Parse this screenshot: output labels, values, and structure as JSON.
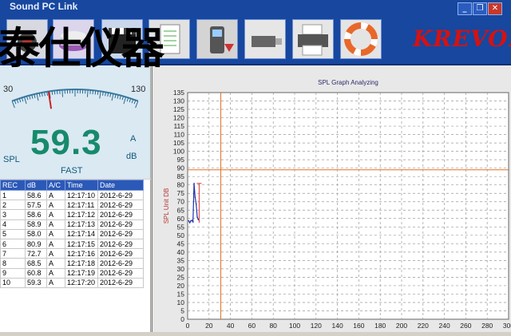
{
  "window": {
    "title": "Sound PC Link",
    "controls": [
      "minimize-icon",
      "restore-icon",
      "close-icon"
    ],
    "watermark": "泰仕仪器",
    "brand": "KREVOR",
    "toolbar_icons": [
      "record-icon",
      "disk-icon",
      "film-clapper-icon",
      "document-icon",
      "device-icon",
      "report-icon",
      "usb-drive-icon",
      "printer-icon",
      "lifebuoy-icon"
    ]
  },
  "meter": {
    "scale_min": "30",
    "scale_max": "130",
    "value": "59.3",
    "spl_label": "SPL",
    "weighting": "A",
    "unit": "dB",
    "response": "FAST",
    "needle_value": 59.3
  },
  "records": {
    "headers": [
      "REC",
      "dB",
      "A/C",
      "Time",
      "Date"
    ],
    "rows": [
      [
        "1",
        "58.6",
        "A",
        "12:17:10",
        "2012-6-29"
      ],
      [
        "2",
        "57.5",
        "A",
        "12:17:11",
        "2012-6-29"
      ],
      [
        "3",
        "58.6",
        "A",
        "12:17:12",
        "2012-6-29"
      ],
      [
        "4",
        "58.9",
        "A",
        "12:17:13",
        "2012-6-29"
      ],
      [
        "5",
        "58.0",
        "A",
        "12:17:14",
        "2012-6-29"
      ],
      [
        "6",
        "80.9",
        "A",
        "12:17:15",
        "2012-6-29"
      ],
      [
        "7",
        "72.7",
        "A",
        "12:17:16",
        "2012-6-29"
      ],
      [
        "8",
        "68.5",
        "A",
        "12:17:18",
        "2012-6-29"
      ],
      [
        "9",
        "60.8",
        "A",
        "12:17:19",
        "2012-6-29"
      ],
      [
        "10",
        "59.3",
        "A",
        "12:17:20",
        "2012-6-29"
      ]
    ]
  },
  "chart_data": {
    "type": "line",
    "title": "SPL Graph Analyzing",
    "xlabel": "",
    "ylabel": "SPL Unit DB",
    "xlim": [
      0,
      300
    ],
    "ylim": [
      0,
      135
    ],
    "xticks": [
      "0",
      "20",
      "40",
      "60",
      "80",
      "100",
      "120",
      "140",
      "160",
      "180",
      "200",
      "220",
      "240",
      "260",
      "280",
      "300"
    ],
    "yticks": [
      "135",
      "130",
      "125",
      "120",
      "115",
      "110",
      "105",
      "100",
      "95",
      "90",
      "85",
      "80",
      "75",
      "70",
      "65",
      "60",
      "55",
      "50",
      "45",
      "40",
      "35",
      "30",
      "25",
      "20",
      "15",
      "10",
      "5",
      "0"
    ],
    "grid": true,
    "series": [
      {
        "x": [
          1,
          2,
          3,
          4,
          5,
          6,
          7,
          8,
          9,
          10
        ],
        "values": [
          58.6,
          57.5,
          58.6,
          58.9,
          58.0,
          80.9,
          72.7,
          68.5,
          60.8,
          59.3
        ],
        "color": "#2233aa"
      }
    ],
    "cursor": {
      "x": 31,
      "y": 89,
      "color": "#e07020"
    },
    "markers": {
      "min_y": 57.5,
      "max_y": 80.9,
      "color": "#dd3333"
    }
  },
  "colors": {
    "accent": "#17479f",
    "value": "#178a6c",
    "brand": "#d41212"
  }
}
